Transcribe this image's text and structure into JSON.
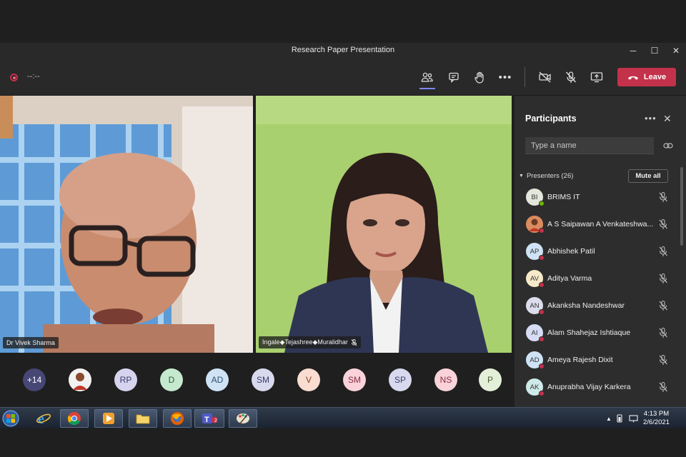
{
  "window": {
    "title": "Research Paper Presentation",
    "minimize": "─",
    "maximize": "☐",
    "close": "✕"
  },
  "toolbar": {
    "timer": "--:--",
    "leave_label": "Leave",
    "icons": [
      "people-icon",
      "chat-icon",
      "raise-hand-icon",
      "more-icon",
      "camera-off-icon",
      "mic-off-icon",
      "share-screen-icon"
    ]
  },
  "videos": [
    {
      "name": "Dr Vivek Sharma",
      "muted": false
    },
    {
      "name": "Ingale◆Tejashree◆Muralidhar",
      "muted": true
    }
  ],
  "avatar_row": [
    {
      "initials": "+14",
      "color": "#464775",
      "text_color": "#ffffff"
    },
    {
      "initials": "",
      "photo": true,
      "color": "#c77b5a"
    },
    {
      "initials": "RP",
      "color": "#d6d3ef",
      "text_color": "#3b3a6b"
    },
    {
      "initials": "D",
      "color": "#c5e9cf",
      "text_color": "#2b5c38"
    },
    {
      "initials": "AD",
      "color": "#cfe3f5",
      "text_color": "#2f4f6f"
    },
    {
      "initials": "SM",
      "color": "#d9d9ee",
      "text_color": "#3b3a6b"
    },
    {
      "initials": "V",
      "color": "#f8ddd0",
      "text_color": "#8a3c1e"
    },
    {
      "initials": "SM",
      "color": "#f9d2da",
      "text_color": "#8a2c3f"
    },
    {
      "initials": "SP",
      "color": "#d9d9ee",
      "text_color": "#3b3a6b"
    },
    {
      "initials": "NS",
      "color": "#f9d2da",
      "text_color": "#8a2c3f"
    },
    {
      "initials": "P",
      "color": "#e4efd9",
      "text_color": "#455c2d"
    }
  ],
  "participants_panel": {
    "title": "Participants",
    "more": "•••",
    "close": "✕",
    "search_placeholder": "Type a name",
    "section_label": "Presenters (26)",
    "mute_all_label": "Mute all",
    "people": [
      {
        "initials": "BI",
        "name": "BRIMS IT",
        "avatar_color": "#e3e6da",
        "status": "#6bb700"
      },
      {
        "initials": "",
        "name": "A S Saipawan A Venkateshwa...",
        "photo": true,
        "avatar_color": "#b25c44",
        "status": "#c4314b"
      },
      {
        "initials": "AP",
        "name": "Abhishek Patil",
        "avatar_color": "#cfe3f5",
        "status": "#c4314b"
      },
      {
        "initials": "AV",
        "name": "Aditya Varma",
        "avatar_color": "#f6e9c8",
        "status": "#c4314b"
      },
      {
        "initials": "AN",
        "name": "Akanksha Nandeshwar",
        "avatar_color": "#dcdcec",
        "status": "#c4314b"
      },
      {
        "initials": "AI",
        "name": "Alam Shahejaz Ishtiaque",
        "avatar_color": "#d6dcf4",
        "status": "#c4314b"
      },
      {
        "initials": "AD",
        "name": "Ameya Rajesh Dixit",
        "avatar_color": "#cfe3f5",
        "status": "#c4314b"
      },
      {
        "initials": "AK",
        "name": "Anuprabha Vijay Karkera",
        "avatar_color": "#cfe9e9",
        "status": "#c4314b"
      }
    ]
  },
  "taskbar": {
    "time": "4:13 PM",
    "date": "2/6/2021",
    "teams_badge": "2"
  }
}
